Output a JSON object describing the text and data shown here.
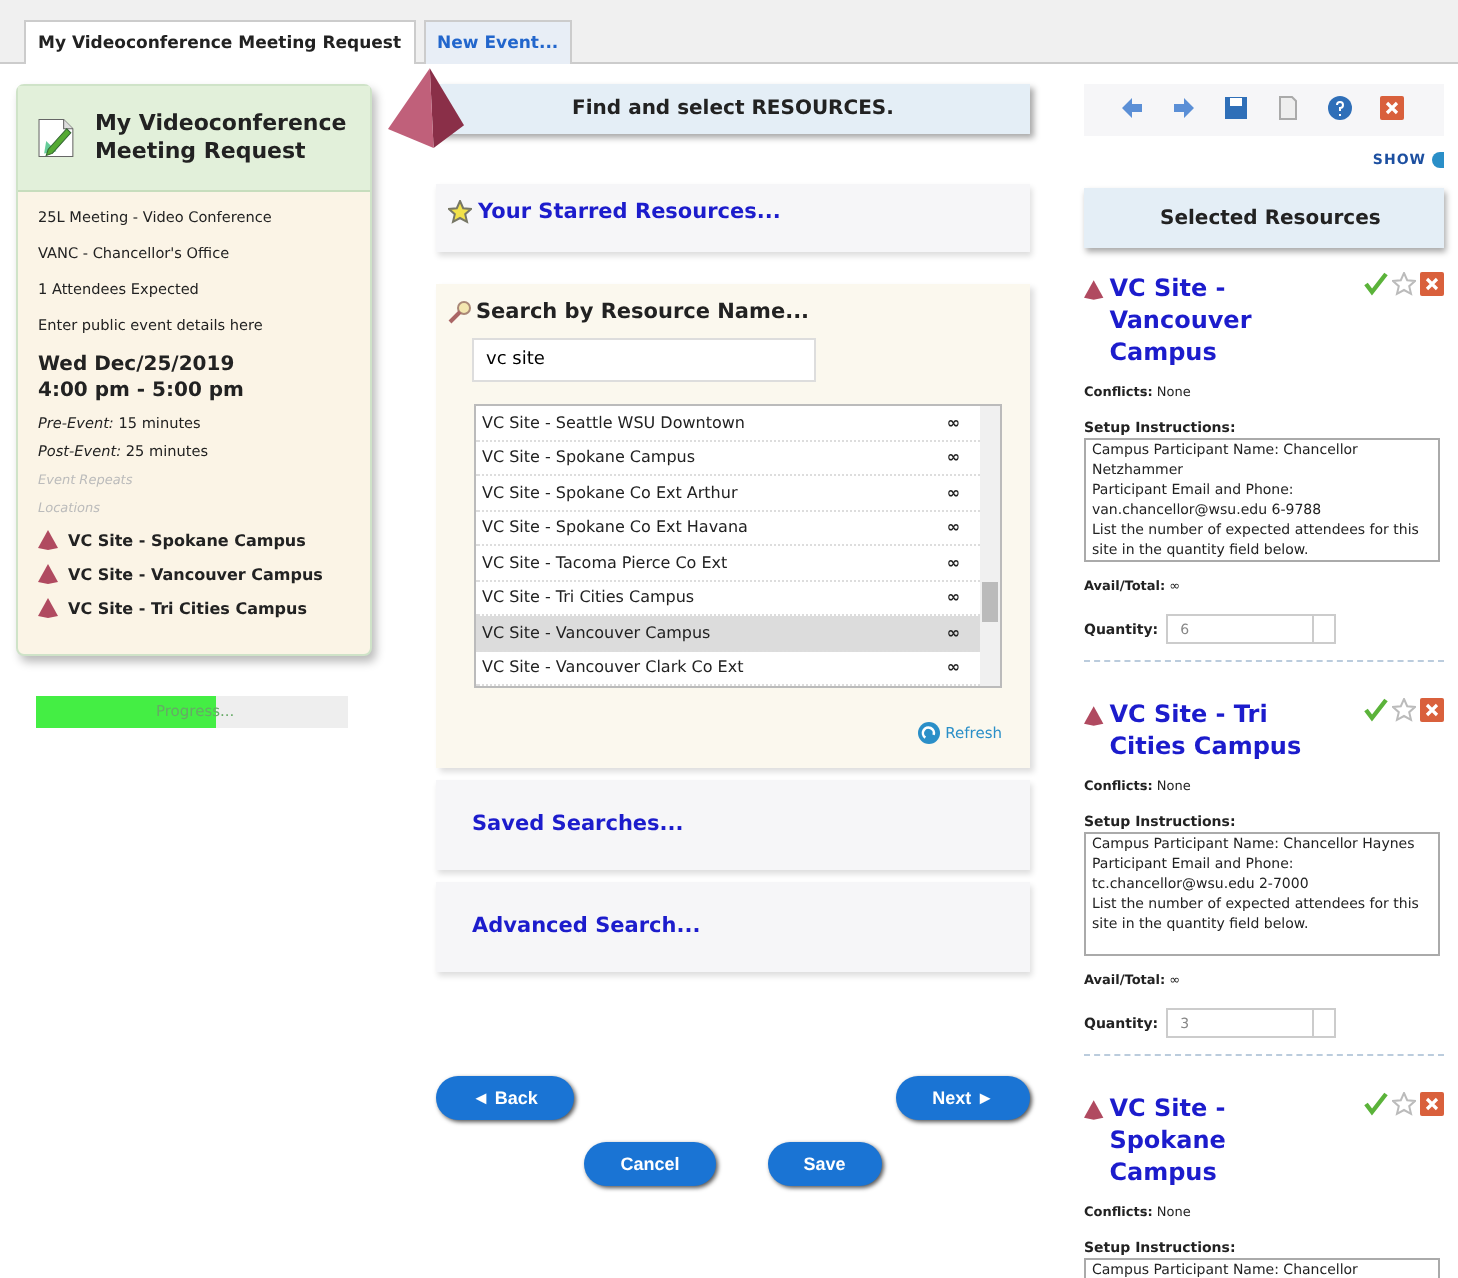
{
  "tabs": [
    {
      "label": "My Videoconference Meeting Request",
      "selected": true
    },
    {
      "label": "New Event...",
      "selected": false
    }
  ],
  "summary": {
    "title": "My Videoconference Meeting Request",
    "details": [
      "25L Meeting - Video Conference",
      "VANC - Chancellor's Office",
      "1 Attendees Expected",
      "Enter public event details here"
    ],
    "date": "Wed Dec/25/2019",
    "time": "4:00 pm - 5:00 pm",
    "pre_event": {
      "label": "Pre-Event:",
      "value": "15 minutes"
    },
    "post_event": {
      "label": "Post-Event:",
      "value": "25 minutes"
    },
    "repeats_label": "Event Repeats",
    "locations_label": "Locations",
    "locations": [
      "VC Site - Spokane Campus",
      "VC Site - Vancouver Campus",
      "VC Site - Tri Cities Campus"
    ]
  },
  "progress": {
    "label": "Progress...",
    "level": 0.58
  },
  "step_title": "Find and select RESOURCES.",
  "starred": "Your Starred Resources...",
  "search": {
    "title": "Search by Resource Name...",
    "value": "vc site",
    "results": [
      {
        "name": "VC Site - Seattle WSU Downtown",
        "avail": "∞",
        "selected": false
      },
      {
        "name": "VC Site - Spokane Campus",
        "avail": "∞",
        "selected": false
      },
      {
        "name": "VC Site - Spokane Co Ext Arthur",
        "avail": "∞",
        "selected": false
      },
      {
        "name": "VC Site - Spokane Co Ext Havana",
        "avail": "∞",
        "selected": false
      },
      {
        "name": "VC Site - Tacoma Pierce Co Ext",
        "avail": "∞",
        "selected": false
      },
      {
        "name": "VC Site - Tri Cities Campus",
        "avail": "∞",
        "selected": false
      },
      {
        "name": "VC Site - Vancouver Campus",
        "avail": "∞",
        "selected": true
      },
      {
        "name": "VC Site - Vancouver Clark Co Ext",
        "avail": "∞",
        "selected": false
      }
    ],
    "refresh": "Refresh"
  },
  "saved_searches": "Saved Searches...",
  "advanced_search": "Advanced Search...",
  "buttons": {
    "back": "◄ Back",
    "next": "Next ►",
    "cancel": "Cancel",
    "save": "Save"
  },
  "show_link": "SHOW",
  "selected_title": "Selected Resources",
  "selected": [
    {
      "name": "VC Site - Vancouver Campus",
      "conflicts_label": "Conflicts:",
      "conflicts": "None",
      "setup_label": "Setup Instructions:",
      "setup": "Campus Participant Name: Chancellor Netzhammer\nParticipant Email and Phone:\nvan.chancellor@wsu.edu 6-9788\nList the number of expected attendees for this site in the quantity field below.",
      "avail_label": "Avail/Total:",
      "avail": "∞",
      "quantity_label": "Quantity:",
      "quantity": "6"
    },
    {
      "name": "VC Site - Tri Cities Campus",
      "conflicts_label": "Conflicts:",
      "conflicts": "None",
      "setup_label": "Setup Instructions:",
      "setup": "Campus Participant Name: Chancellor Haynes\nParticipant Email and Phone:\ntc.chancellor@wsu.edu 2-7000\nList the number of expected attendees for this site in the quantity field below.",
      "avail_label": "Avail/Total:",
      "avail": "∞",
      "quantity_label": "Quantity:",
      "quantity": "3"
    },
    {
      "name": "VC Site - Spokane Campus",
      "conflicts_label": "Conflicts:",
      "conflicts": "None",
      "setup_label": "Setup Instructions:",
      "setup": "Campus Participant Name: Chancellor"
    }
  ]
}
